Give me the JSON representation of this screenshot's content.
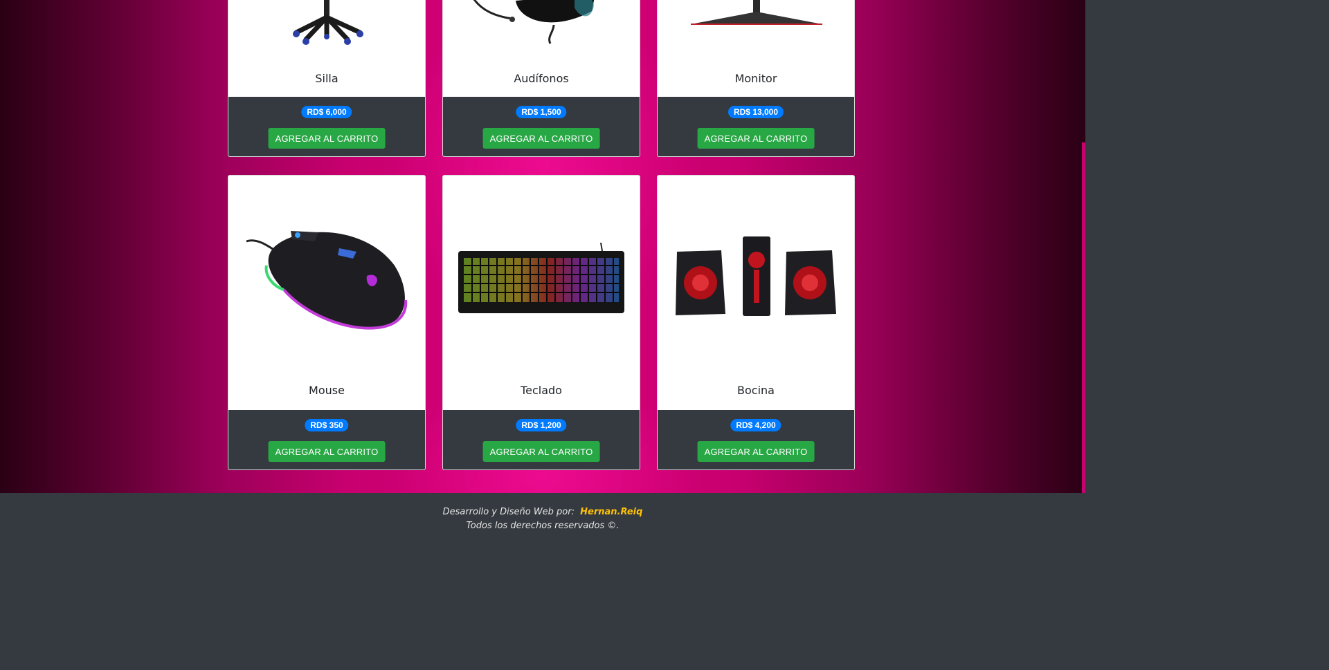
{
  "products": [
    {
      "name": "Silla",
      "price": "RD$ 6,000",
      "button": "AGREGAR AL CARRITO",
      "icon": "office-chair-image"
    },
    {
      "name": "Audífonos",
      "price": "RD$ 1,500",
      "button": "AGREGAR AL CARRITO",
      "icon": "headset-image"
    },
    {
      "name": "Monitor",
      "price": "RD$ 13,000",
      "button": "AGREGAR AL CARRITO",
      "icon": "monitor-image"
    },
    {
      "name": "Mouse",
      "price": "RD$ 350",
      "button": "AGREGAR AL CARRITO",
      "icon": "gaming-mouse-image"
    },
    {
      "name": "Teclado",
      "price": "RD$ 1,200",
      "button": "AGREGAR AL CARRITO",
      "icon": "rgb-keyboard-image"
    },
    {
      "name": "Bocina",
      "price": "RD$ 4,200",
      "button": "AGREGAR AL CARRITO",
      "icon": "speaker-set-image"
    }
  ],
  "footer": {
    "credit_prefix": "Desarrollo y Diseño Web por:",
    "author": "Hernan.Reiq",
    "rights": "Todos los derechos reservados ©."
  },
  "colors": {
    "badge": "#007bff",
    "button": "#28a745",
    "card_footer": "#343a40",
    "accent_pink": "#e6007e",
    "author": "#ffc107"
  }
}
